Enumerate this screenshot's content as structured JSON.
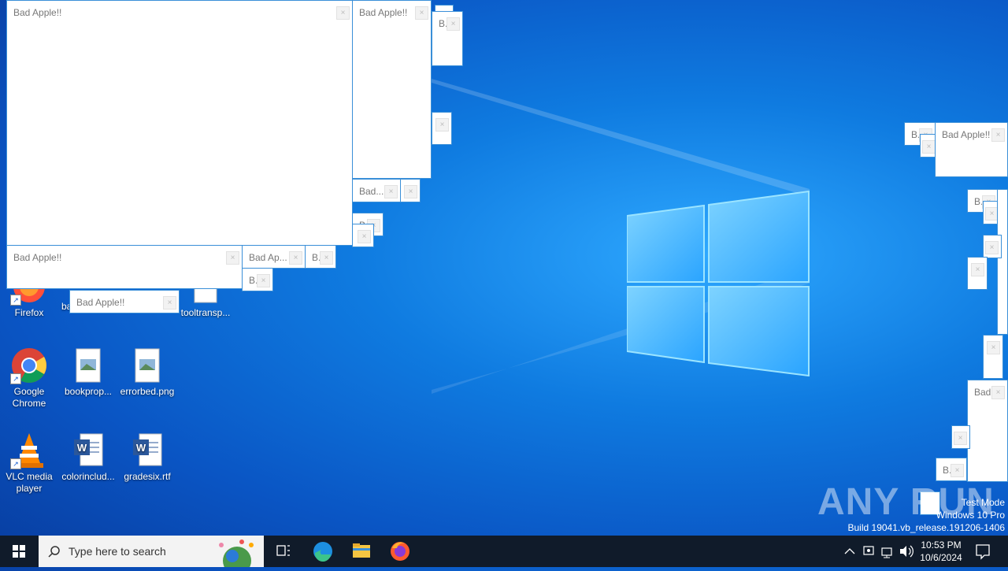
{
  "desktop": {
    "icons": [
      {
        "label": "Firefox"
      },
      {
        "label": "ba"
      },
      {
        "label": "tooltransp..."
      },
      {
        "label": "Google Chrome"
      },
      {
        "label": "bookprop..."
      },
      {
        "label": "errorbed.png"
      },
      {
        "label": "VLC media player"
      },
      {
        "label": "colorinclud..."
      },
      {
        "label": "gradesix.rtf"
      }
    ]
  },
  "windows": {
    "full_title": "Bad Apple!!",
    "trunc_ap": "Bad Ap...",
    "trunc_bad": "Bad...",
    "trunc_b": "B...",
    "trunc_b_short": "B.",
    "close_glyph": "×"
  },
  "watermark": {
    "brand": "ANY RUN",
    "mode": "Test Mode",
    "edition": "Windows 10 Pro",
    "build": "Build 19041.vb_release.191206-1406"
  },
  "taskbar": {
    "search_placeholder": "Type here to search",
    "time": "10:53 PM",
    "date": "10/6/2024"
  },
  "colors": {
    "taskbar_bg": "#101b2a",
    "window_border": "#3a8fd8",
    "desktop_blue": "#0f7be0"
  }
}
